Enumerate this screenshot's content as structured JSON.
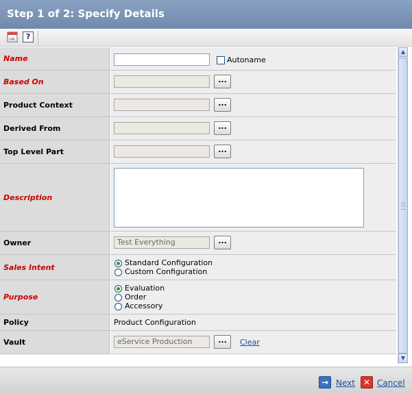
{
  "window": {
    "title": "Step 1 of 2: Specify Details"
  },
  "toolbar": {
    "url_icon_text": "URL",
    "help_icon_text": "?"
  },
  "form": {
    "name": {
      "label": "Name",
      "value": "",
      "autoname_label": "Autoname",
      "autoname_checked": false
    },
    "based_on": {
      "label": "Based On",
      "value": "",
      "browse_label": "..."
    },
    "product_context": {
      "label": "Product Context",
      "value": "",
      "browse_label": "..."
    },
    "derived_from": {
      "label": "Derived From",
      "value": "",
      "browse_label": "..."
    },
    "top_level_part": {
      "label": "Top Level Part",
      "value": "",
      "browse_label": "..."
    },
    "description": {
      "label": "Description",
      "value": ""
    },
    "owner": {
      "label": "Owner",
      "value": "Test Everything",
      "browse_label": "..."
    },
    "sales_intent": {
      "label": "Sales Intent",
      "options": [
        "Standard Configuration",
        "Custom Configuration"
      ],
      "selected": "Standard Configuration"
    },
    "purpose": {
      "label": "Purpose",
      "options": [
        "Evaluation",
        "Order",
        "Accessory"
      ],
      "selected": "Evaluation"
    },
    "policy": {
      "label": "Policy",
      "value": "Product Configuration"
    },
    "vault": {
      "label": "Vault",
      "value": "eService Production",
      "browse_label": "...",
      "clear_label": "Clear"
    }
  },
  "footer": {
    "next_label": "Next",
    "cancel_label": "Cancel"
  },
  "colors": {
    "required_label": "#cc0000",
    "title_bar": "#7a93b6",
    "link": "#1a4fa0"
  }
}
